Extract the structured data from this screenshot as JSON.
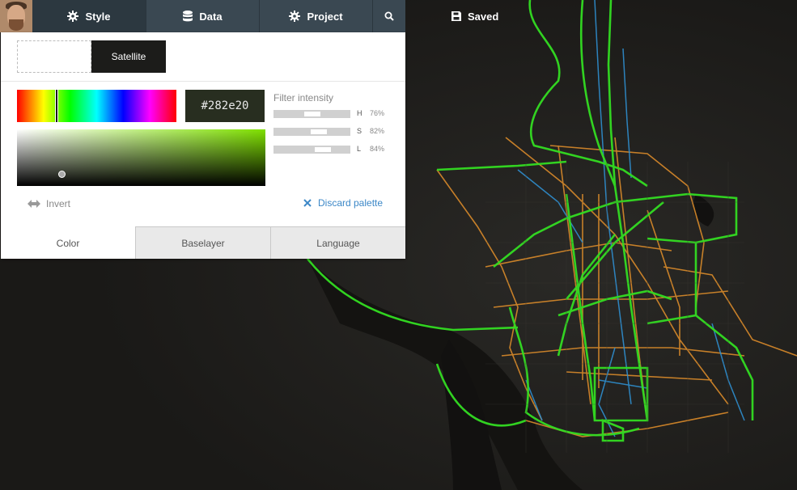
{
  "topbar": {
    "tabs": [
      {
        "label": "Style",
        "icon": "gear-icon"
      },
      {
        "label": "Data",
        "icon": "database-icon"
      },
      {
        "label": "Project",
        "icon": "gear-icon"
      }
    ],
    "search_icon": "search-icon",
    "status": "Saved",
    "status_icon": "save-icon"
  },
  "baselayer": {
    "selected": "Satellite"
  },
  "color": {
    "hex": "#282e20",
    "filter_title": "Filter intensity",
    "filters": [
      {
        "letter": "H",
        "value": "76%"
      },
      {
        "letter": "S",
        "value": "82%"
      },
      {
        "letter": "L",
        "value": "84%"
      }
    ],
    "invert_label": "Invert",
    "discard_label": "Discard palette"
  },
  "subtabs": [
    "Color",
    "Baselayer",
    "Language"
  ],
  "colors": {
    "accent": "#3b87c7",
    "toolbar": "#3a4852",
    "route_green": "#33dd22",
    "route_orange": "#d98a2a",
    "route_blue": "#2f8fd0"
  }
}
